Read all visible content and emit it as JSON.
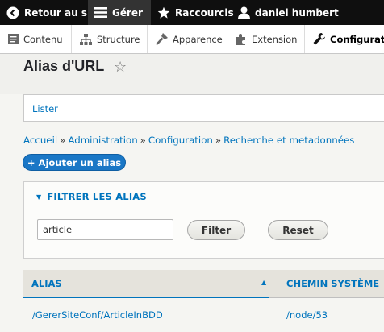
{
  "toolbar": {
    "back_label": "Retour au site",
    "manage_label": "Gérer",
    "shortcuts_label": "Raccourcis",
    "user_label": "daniel humbert"
  },
  "tray": {
    "items": [
      {
        "label": "Contenu",
        "icon": "content-icon"
      },
      {
        "label": "Structure",
        "icon": "structure-icon"
      },
      {
        "label": "Apparence",
        "icon": "appearance-icon"
      },
      {
        "label": "Extension",
        "icon": "extension-icon"
      },
      {
        "label": "Configuratio",
        "icon": "wrench-icon"
      }
    ]
  },
  "page": {
    "title": "Alias d'URL",
    "star": "☆"
  },
  "tabs": {
    "list_label": "Lister"
  },
  "breadcrumb": {
    "items": [
      "Accueil",
      "Administration",
      "Configuration",
      "Recherche et metadonnées"
    ],
    "separator": "»"
  },
  "actions": {
    "add_label": "+ Ajouter un alias"
  },
  "filter": {
    "legend": "FILTRER LES ALIAS",
    "input_value": "article",
    "filter_button": "Filter",
    "reset_button": "Reset"
  },
  "table": {
    "columns": [
      "ALIAS",
      "CHEMIN SYSTÈME"
    ],
    "rows": [
      {
        "alias": "/GererSiteConf/ArticleInBDD",
        "path": "/node/53"
      }
    ]
  },
  "colors": {
    "link": "#0074bd",
    "primary_button": "#1a77c6",
    "toolbar": "#0f0f0f"
  }
}
